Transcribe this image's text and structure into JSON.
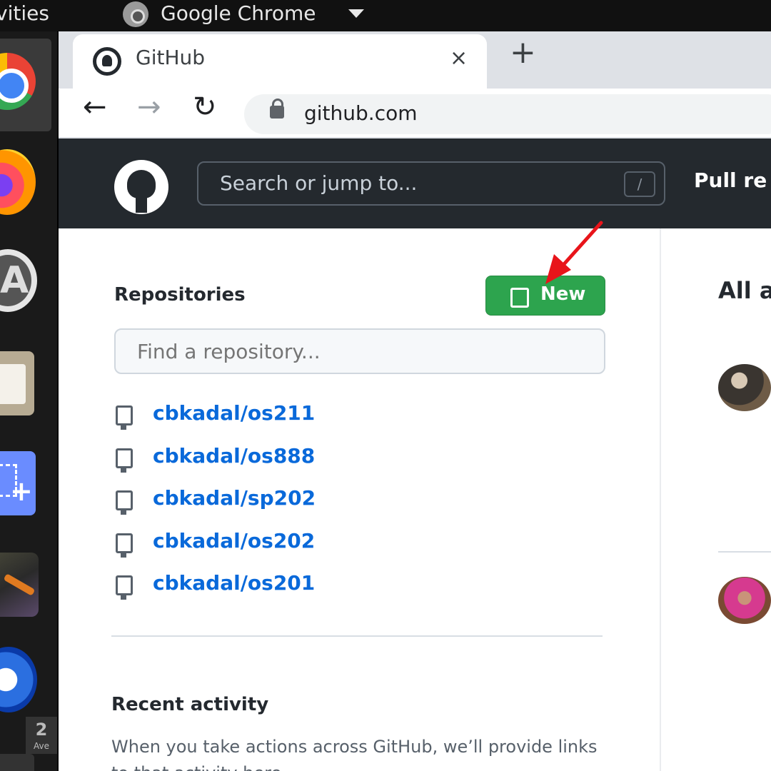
{
  "topbar": {
    "activities": "vities",
    "app_name": "Google Chrome"
  },
  "dock": {
    "calendar_day": "2",
    "calendar_sub": "Ave"
  },
  "browser": {
    "tab_title": "GitHub",
    "tab_close": "×",
    "new_tab": "+",
    "back": "←",
    "forward": "→",
    "reload": "↻",
    "url": "github.com"
  },
  "github": {
    "search_placeholder": "Search or jump to...",
    "search_shortcut": "/",
    "nav_pull": "Pull re",
    "repositories_heading": "Repositories",
    "new_button": "New",
    "find_placeholder": "Find a repository...",
    "repos": [
      "cbkadal/os211",
      "cbkadal/os888",
      "cbkadal/sp202",
      "cbkadal/os202",
      "cbkadal/os201"
    ],
    "recent_heading": "Recent activity",
    "recent_text": "When you take actions across GitHub, we’ll provide links to that activity here.",
    "feed_heading": "All a"
  },
  "colors": {
    "new_button": "#2da44e",
    "link": "#0969da",
    "header": "#24292e",
    "annotation_arrow": "#e8141a"
  }
}
